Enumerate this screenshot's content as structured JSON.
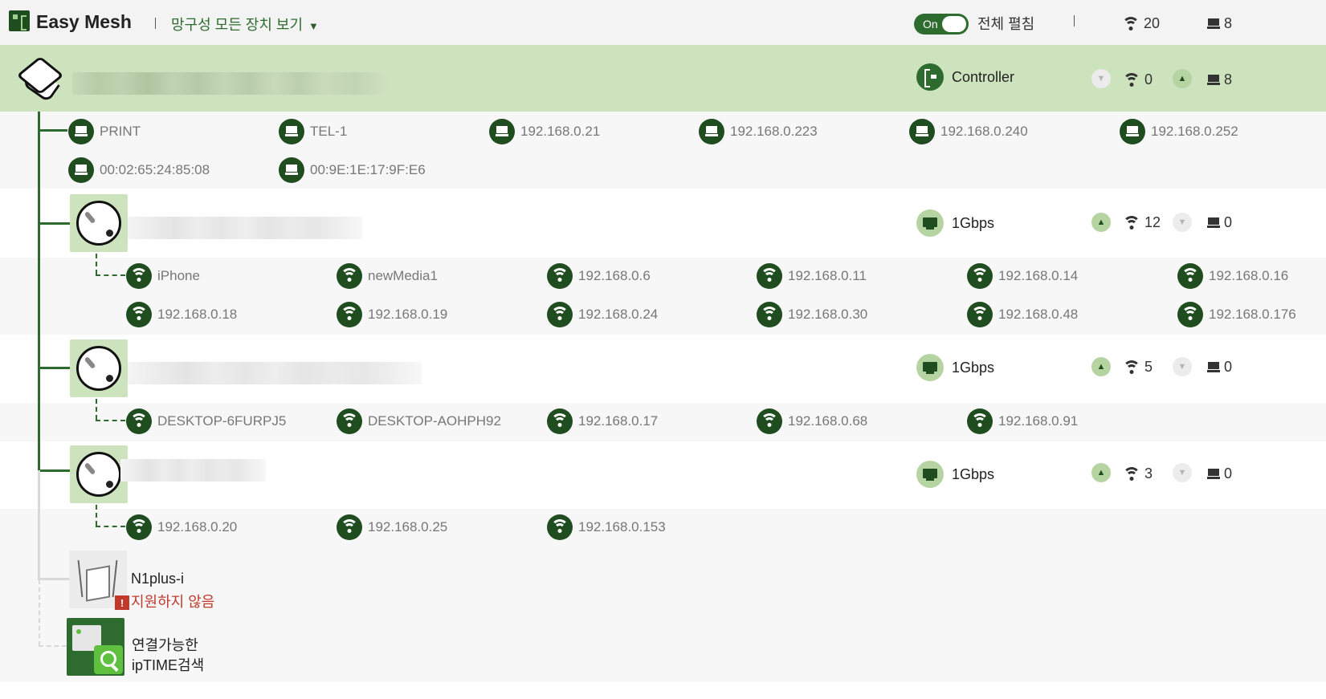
{
  "header": {
    "app_title": "Easy Mesh",
    "view_select": "망구성 모든 장치 보기",
    "toggle_state": "On",
    "expand_all_label": "전체 펼침",
    "wifi_total": "20",
    "wired_total": "8"
  },
  "controller": {
    "role_label": "Controller",
    "wifi_count": "0",
    "wired_count": "8",
    "clients": [
      "PRINT",
      "TEL-1",
      "192.168.0.21",
      "192.168.0.223",
      "192.168.0.240",
      "192.168.0.252",
      "00:02:65:24:85:08",
      "00:9E:1E:17:9F:E6"
    ]
  },
  "agents": [
    {
      "link_speed": "1Gbps",
      "wifi_count": "12",
      "wired_count": "0",
      "clients": [
        "iPhone",
        "newMedia1",
        "192.168.0.6",
        "192.168.0.11",
        "192.168.0.14",
        "192.168.0.16",
        "192.168.0.18",
        "192.168.0.19",
        "192.168.0.24",
        "192.168.0.30",
        "192.168.0.48",
        "192.168.0.176"
      ]
    },
    {
      "link_speed": "1Gbps",
      "wifi_count": "5",
      "wired_count": "0",
      "clients": [
        "DESKTOP-6FURPJ5",
        "DESKTOP-AOHPH92",
        "192.168.0.17",
        "192.168.0.68",
        "192.168.0.91"
      ]
    },
    {
      "link_speed": "1Gbps",
      "wifi_count": "3",
      "wired_count": "0",
      "clients": [
        "192.168.0.20",
        "192.168.0.25",
        "192.168.0.153"
      ]
    }
  ],
  "unsupported": {
    "name": "N1plus-i",
    "status": "지원하지 않음",
    "status_color": "#c0392b"
  },
  "search": {
    "line1": "연결가능한",
    "line2": "ipTIME검색"
  },
  "colors": {
    "accent": "#2e6b2e",
    "controller_bg": "#cde3bd"
  }
}
